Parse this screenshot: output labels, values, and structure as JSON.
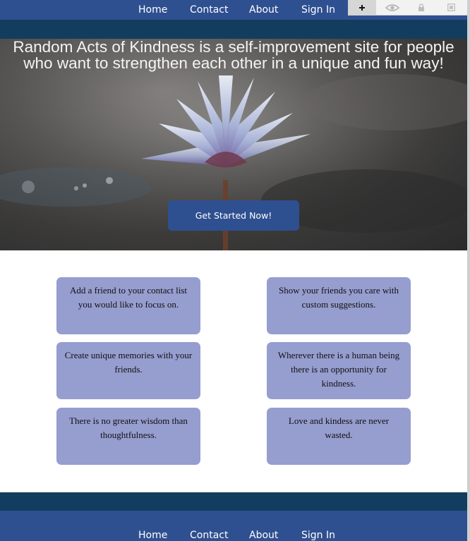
{
  "nav": {
    "home": "Home",
    "contact": "Contact",
    "about": "About",
    "signin": "Sign In"
  },
  "toolbar": {
    "icons": [
      "plus-icon",
      "eye-icon",
      "lock-icon",
      "box-icon"
    ]
  },
  "hero": {
    "headline": "Random Acts of Kindness is a self-improvement site for people who want to strengthen each other in a unique and fun way!",
    "cta_label": "Get Started Now!"
  },
  "cards": [
    "Add a friend to your contact list you would like to focus on.",
    "Show your friends you care with custom suggestions.",
    "Create unique memories with your friends.",
    "Wherever there is a human being there is an opportunity for kindness.",
    "There is no greater wisdom than thoughtfulness.",
    "Love and kindess are never wasted."
  ],
  "footer_nav": {
    "home": "Home",
    "contact": "Contact",
    "about": "About",
    "signin": "Sign In"
  },
  "colors": {
    "nav_blue": "#2f5090",
    "dark_band": "#133d5f",
    "card": "#969dcf"
  }
}
